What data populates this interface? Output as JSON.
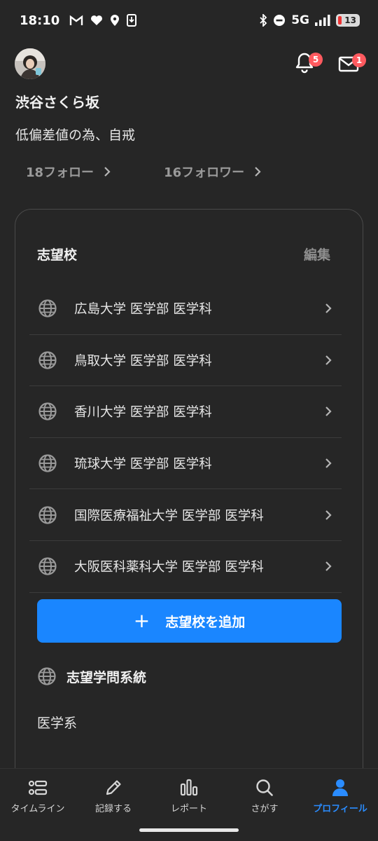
{
  "status_bar": {
    "time": "18:10",
    "network": "5G",
    "battery": "13"
  },
  "header": {
    "notifications_count": "5",
    "messages_count": "1"
  },
  "profile": {
    "username": "渋谷さくら坂",
    "bio": "低偏差値の為、自戒",
    "following": "18フォロー",
    "followers": "16フォロワー"
  },
  "schools_card": {
    "title": "志望校",
    "edit_label": "編集",
    "schools": [
      "広島大学 医学部 医学科",
      "鳥取大学 医学部 医学科",
      "香川大学 医学部 医学科",
      "琉球大学 医学部 医学科",
      "国際医療福祉大学 医学部 医学科",
      "大阪医科薬科大学 医学部 医学科"
    ],
    "add_button_label": "志望校を追加",
    "field_title": "志望学問系統",
    "field_value": "医学系"
  },
  "bottom_nav": {
    "items": [
      "タイムライン",
      "記録する",
      "レポート",
      "さがす",
      "プロフィール"
    ],
    "active": "プロフィール"
  },
  "colors": {
    "background": "#262626",
    "accent": "#1a86ff",
    "badge": "#ff5a5f"
  }
}
